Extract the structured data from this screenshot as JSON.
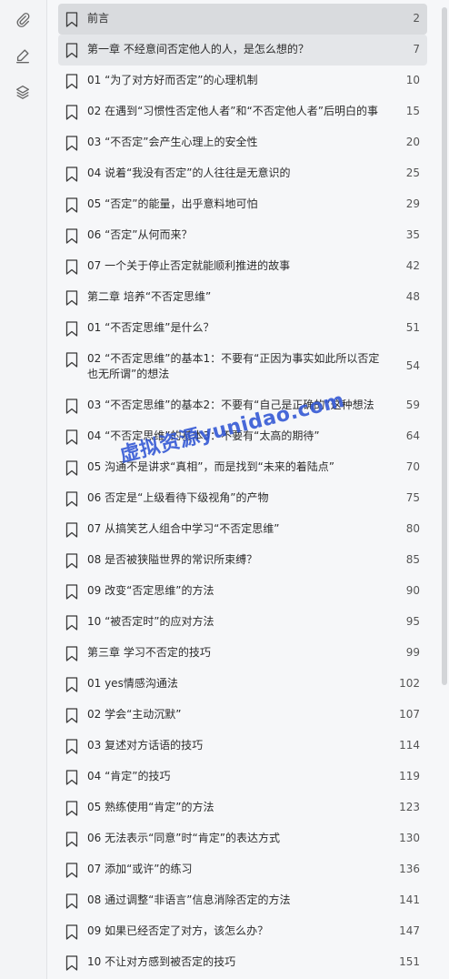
{
  "sidebar": {
    "icons": [
      "paperclip-icon",
      "pen-icon",
      "layers-icon"
    ]
  },
  "toc": [
    {
      "title": "前言",
      "page": "2"
    },
    {
      "title": "第一章 不经意间否定他人的人，是怎么想的？",
      "page": "7"
    },
    {
      "title": "01 “为了对方好而否定”的心理机制",
      "page": "10"
    },
    {
      "title": "02 在遇到“习惯性否定他人者”和“不否定他人者”后明白的事",
      "page": "15"
    },
    {
      "title": "03 “不否定”会产生心理上的安全性",
      "page": "20"
    },
    {
      "title": "04 说着“我没有否定”的人往往是无意识的",
      "page": "25"
    },
    {
      "title": "05 “否定”的能量，出乎意料地可怕",
      "page": "29"
    },
    {
      "title": "06 “否定”从何而来？",
      "page": "35"
    },
    {
      "title": "07 一个关于停止否定就能顺利推进的故事",
      "page": "42"
    },
    {
      "title": "第二章 培养“不否定思维”",
      "page": "48"
    },
    {
      "title": "01 “不否定思维”是什么？",
      "page": "51"
    },
    {
      "title": "02 “不否定思维”的基本1：不要有“正因为事实如此所以否定也无所谓”的想法",
      "page": "54"
    },
    {
      "title": "03 “不否定思维”的基本2：不要有“自己是正确的”这种想法",
      "page": "59"
    },
    {
      "title": "04 “不否定思维”的基本3：不要有“太高的期待”",
      "page": "64"
    },
    {
      "title": "05 沟通不是讲求“真相”，而是找到“未来的着陆点”",
      "page": "70"
    },
    {
      "title": "06 否定是“上级看待下级视角”的产物",
      "page": "75"
    },
    {
      "title": "07 从搞笑艺人组合中学习“不否定思维”",
      "page": "80"
    },
    {
      "title": "08 是否被狭隘世界的常识所束缚？",
      "page": "85"
    },
    {
      "title": "09 改变“否定思维”的方法",
      "page": "90"
    },
    {
      "title": "10 “被否定时”的应对方法",
      "page": "95"
    },
    {
      "title": "第三章 学习不否定的技巧",
      "page": "99"
    },
    {
      "title": "01 yes情感沟通法",
      "page": "102"
    },
    {
      "title": "02 学会“主动沉默”",
      "page": "107"
    },
    {
      "title": "03 复述对方话语的技巧",
      "page": "114"
    },
    {
      "title": "04 “肯定”的技巧",
      "page": "119"
    },
    {
      "title": "05 熟练使用“肯定”的方法",
      "page": "123"
    },
    {
      "title": "06 无法表示“同意”时“肯定”的表达方式",
      "page": "130"
    },
    {
      "title": "07 添加“或许”的练习",
      "page": "136"
    },
    {
      "title": "08 通过调整“非语言”信息消除否定的方法",
      "page": "141"
    },
    {
      "title": "09 如果已经否定了对方，该怎么办？",
      "page": "147"
    },
    {
      "title": "10 不让对方感到被否定的技巧",
      "page": "151"
    }
  ],
  "watermark": "虚拟资源yunidao.com"
}
